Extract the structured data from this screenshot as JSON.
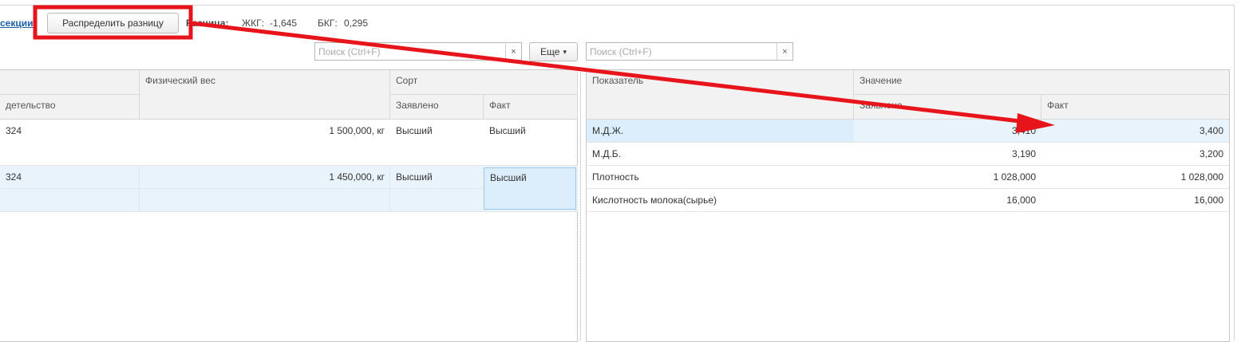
{
  "toolbar": {
    "link_label": "секции",
    "distribute_button": "Распределить разницу",
    "difference_label": "Разница:",
    "zhkg_label": "ЖКГ:",
    "zhkg_value": "-1,645",
    "bkg_label": "БКГ:",
    "bkg_value": "0,295"
  },
  "left_panel": {
    "search_placeholder": "Поиск (Ctrl+F)",
    "clear_glyph": "×",
    "more_button": "Еще",
    "more_arrow": "▾",
    "headers": {
      "col1_sub": "детельство",
      "physical_weight": "Физический вес",
      "grade": "Сорт",
      "declared": "Заявлено",
      "fact": "Факт"
    },
    "rows": [
      {
        "id": "324",
        "weight": "1 500,000, кг",
        "declared": "Высший",
        "fact": "Высший"
      },
      {
        "id": "324",
        "weight": "1 450,000, кг",
        "declared": "Высший",
        "fact": "Высший"
      }
    ]
  },
  "right_panel": {
    "search_placeholder": "Поиск (Ctrl+F)",
    "clear_glyph": "×",
    "headers": {
      "indicator": "Показатель",
      "value": "Значение",
      "declared": "Заявлено",
      "fact": "Факт"
    },
    "rows": [
      {
        "name": "М.Д.Ж.",
        "declared": "3,410",
        "fact": "3,400"
      },
      {
        "name": "М.Д.Б.",
        "declared": "3,190",
        "fact": "3,200"
      },
      {
        "name": "Плотность",
        "declared": "1 028,000",
        "fact": "1 028,000"
      },
      {
        "name": "Кислотность молока(сырье)",
        "declared": "16,000",
        "fact": "16,000"
      }
    ]
  },
  "annotation": {
    "color": "#e8141b"
  }
}
